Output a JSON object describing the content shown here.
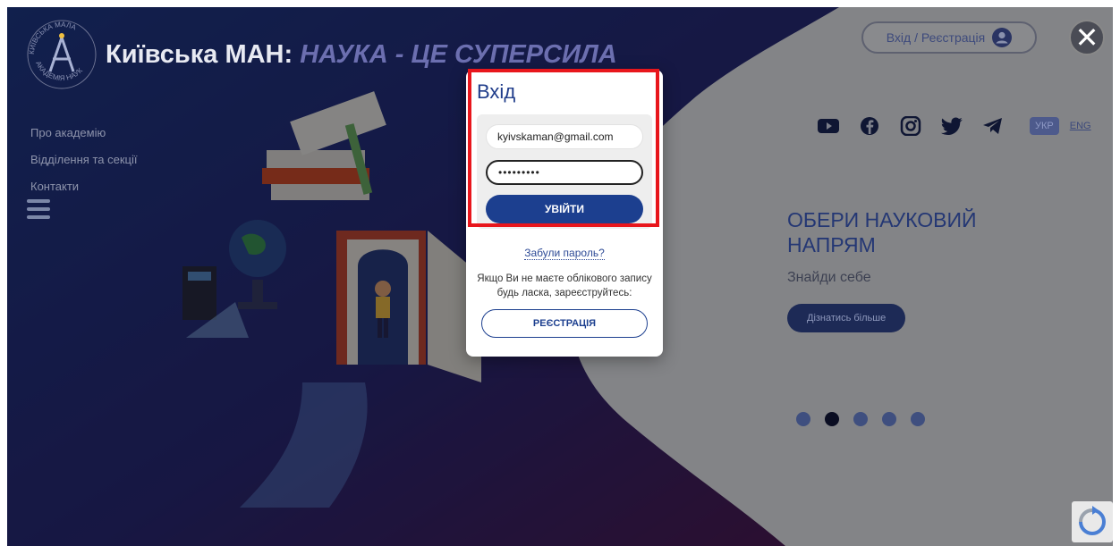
{
  "brand": {
    "name": "Київська МАН:",
    "tagline": "НАУКА - ЦЕ СУПЕРСИЛА",
    "logo_text_top": "КИЇВСЬКА МАЛА",
    "logo_text_bottom": "АКАДЕМІЯ НАУК"
  },
  "nav": {
    "items": [
      {
        "label": "Про академію"
      },
      {
        "label": "Відділення та секції"
      },
      {
        "label": "Контакти"
      }
    ]
  },
  "header": {
    "login_label": "Вхід / Реєстрація",
    "close_glyph": "✕"
  },
  "socials": [
    "youtube-icon",
    "facebook-icon",
    "instagram-icon",
    "twitter-icon",
    "telegram-icon"
  ],
  "lang": {
    "ukr": "УКР",
    "eng": "ENG"
  },
  "hero": {
    "title": "ОБЕРИ НАУКОВИЙ НАПРЯМ",
    "subtitle": "Знайди себе",
    "button": "Дізнатись більше"
  },
  "slider": {
    "count": 5,
    "active_index": 1
  },
  "modal": {
    "title": "Вхід",
    "email_value": "kyivskaman@gmail.com",
    "password_value": "secretpwd",
    "submit_label": "УВІЙТИ",
    "forgot_label": "Забули пароль?",
    "register_note": "Якщо Ви не маєте облікового запису будь ласка, зареєструйтесь:",
    "register_label": "РЕЄСТРАЦІЯ"
  },
  "colors": {
    "accent": "#1c3f8f",
    "highlight": "#e8161c",
    "dark_bg": "#1b1e4a"
  }
}
